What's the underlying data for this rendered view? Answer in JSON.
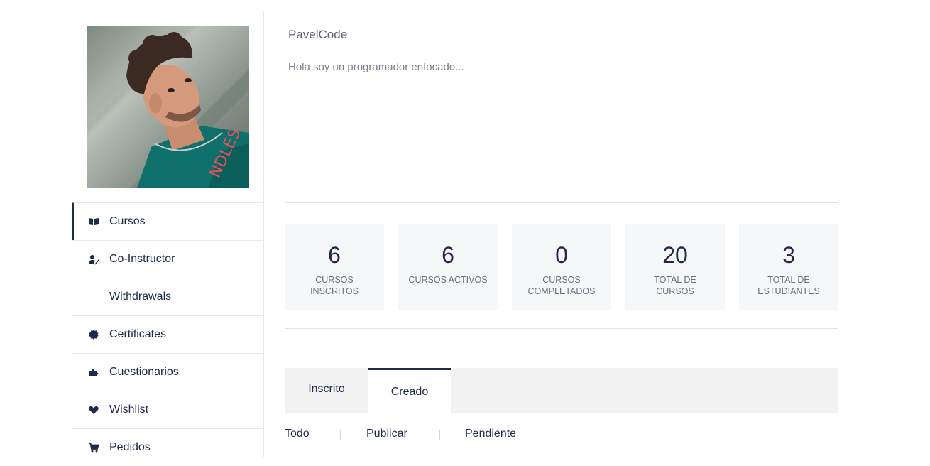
{
  "profile": {
    "username": "PavelCode",
    "bio": "Hola soy un programador enfocado..."
  },
  "sidebar": {
    "items": [
      {
        "label": "Cursos",
        "icon": "book-open-icon",
        "active": true
      },
      {
        "label": "Co-Instructor",
        "icon": "user-edit-icon",
        "active": false
      },
      {
        "label": "Withdrawals",
        "icon": "",
        "active": false
      },
      {
        "label": "Certificates",
        "icon": "certificate-icon",
        "active": false
      },
      {
        "label": "Cuestionarios",
        "icon": "puzzle-piece-icon",
        "active": false
      },
      {
        "label": "Wishlist",
        "icon": "heart-icon",
        "active": false
      },
      {
        "label": "Pedidos",
        "icon": "shopping-cart-icon",
        "active": false
      }
    ]
  },
  "stats": [
    {
      "value": "6",
      "label": "CURSOS INSCRITOS"
    },
    {
      "value": "6",
      "label": "CURSOS ACTIVOS"
    },
    {
      "value": "0",
      "label": "CURSOS COMPLETADOS"
    },
    {
      "value": "20",
      "label": "TOTAL DE CURSOS"
    },
    {
      "value": "3",
      "label": "TOTAL DE ESTUDIANTES"
    }
  ],
  "tabs": [
    {
      "label": "Inscrito",
      "active": false
    },
    {
      "label": "Creado",
      "active": true
    }
  ],
  "filters": [
    "Todo",
    "Publicar",
    "Pendiente"
  ],
  "colors": {
    "primary": "#1e2a47",
    "stat_background": "#f6f7f9",
    "tab_bar_background": "#f2f2f2",
    "divider": "#e1e3e7"
  }
}
